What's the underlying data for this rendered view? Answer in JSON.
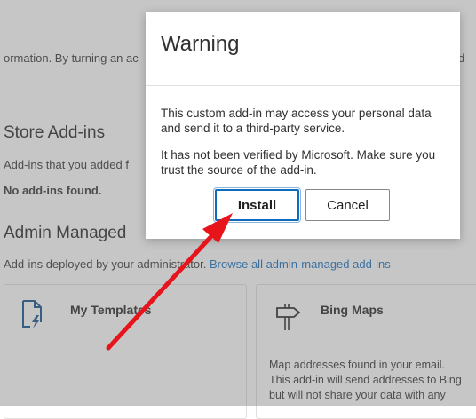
{
  "background": {
    "top_partial": "ormation. By turning an ac",
    "top_partial_right": "d",
    "store_heading": "Store Add-ins",
    "store_desc": "Add-ins that you added f",
    "store_empty": "No add-ins found.",
    "admin_heading": "Admin Managed",
    "admin_desc": "Add-ins deployed by your administrator.",
    "admin_link": "Browse all admin-managed add-ins",
    "cards": [
      {
        "title": "My Templates",
        "icon": "template-document-icon",
        "desc": []
      },
      {
        "title": "Bing Maps",
        "icon": "signpost-icon",
        "desc": [
          "Map addresses found in your email.",
          "This add-in will send addresses to Bing",
          "but will not share your data with any"
        ]
      }
    ]
  },
  "dialog": {
    "title": "Warning",
    "body1": "This custom add-in may access your personal data and send it to a third-party service.",
    "body2": "It has not been verified by Microsoft. Make sure you trust the source of the add-in.",
    "install_label": "Install",
    "cancel_label": "Cancel"
  },
  "colors": {
    "accent": "#0f6cbd",
    "annotation_arrow": "#e8141c",
    "overlay": "rgba(120,120,120,0.42)"
  }
}
